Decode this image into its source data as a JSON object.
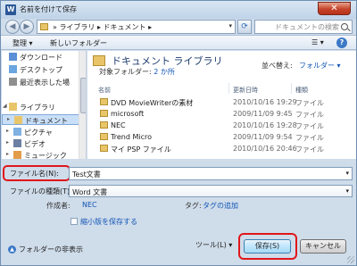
{
  "window": {
    "title": "名前を付けて保存",
    "app_icon_letter": "W",
    "close_glyph": "✕"
  },
  "address": {
    "path": "» ライブラリ ▸ ドキュメント ▸",
    "search_placeholder": "ドキュメントの検索"
  },
  "toolbar": {
    "organize_label": "整理 ▾",
    "new_folder_label": "新しいフォルダー",
    "views_glyph": "☰ ▾",
    "help_glyph": "?"
  },
  "nav": {
    "items": [
      {
        "label": "ダウンロード",
        "icon": "download-folder-icon",
        "color": "#5b8fd6"
      },
      {
        "label": "デスクトップ",
        "icon": "desktop-icon",
        "color": "#6aa6e0"
      },
      {
        "label": "最近表示した場",
        "icon": "recent-places-icon",
        "color": "#8f8f8f"
      },
      {
        "label": "ライブラリ",
        "icon": "library-icon",
        "color": "#e9c56a"
      },
      {
        "label": "ドキュメント",
        "icon": "documents-icon",
        "color": "#e9c56a"
      },
      {
        "label": "ピクチャ",
        "icon": "pictures-icon",
        "color": "#7fb1e3"
      },
      {
        "label": "ビデオ",
        "icon": "videos-icon",
        "color": "#6b7fa3"
      },
      {
        "label": "ミュージック",
        "icon": "music-icon",
        "color": "#e39c4a"
      }
    ],
    "expand_glyph": "▸",
    "collapse_glyph": "◢"
  },
  "main": {
    "title": "ドキュメント ライブラリ",
    "subtitle_prefix": "対象フォルダー: ",
    "subtitle_link": "2 か所",
    "arrange_label": "並べ替え:",
    "arrange_value": "フォルダー ▾",
    "columns": {
      "name": "名前",
      "date": "更新日時",
      "type": "種類"
    },
    "rows": [
      {
        "name": "DVD MovieWriterの素材",
        "date": "2010/10/16 19:29",
        "type": "ファイル"
      },
      {
        "name": "microsoft",
        "date": "2009/11/09 9:45",
        "type": "ファイル"
      },
      {
        "name": "NEC",
        "date": "2010/10/16 19:28",
        "type": "ファイル"
      },
      {
        "name": "Trend Micro",
        "date": "2009/11/09 9:54",
        "type": "ファイル"
      },
      {
        "name": "マイ PSP ファイル",
        "date": "2010/10/16 20:46",
        "type": "ファイル"
      }
    ]
  },
  "form": {
    "filename_label": "ファイル名(N):",
    "filename_value": "Test文書",
    "filetype_label": "ファイルの種類(T):",
    "filetype_value": "Word 文書",
    "author_label": "作成者:",
    "author_value": "NEC",
    "tags_label": "タグ:",
    "tags_value": "タグの追加",
    "thumbnail_label": "縮小版を保存する",
    "dropdown_glyph": "▾"
  },
  "footer": {
    "hide_folders_label": "フォルダーの非表示",
    "hide_glyph": "▲",
    "tools_label": "ツール(L) ▾",
    "save_label": "保存(S)",
    "cancel_label": "キャンセル"
  },
  "colors": {
    "highlight": "#e0171a",
    "link": "#1155b5",
    "selection": "#c9dff7"
  }
}
